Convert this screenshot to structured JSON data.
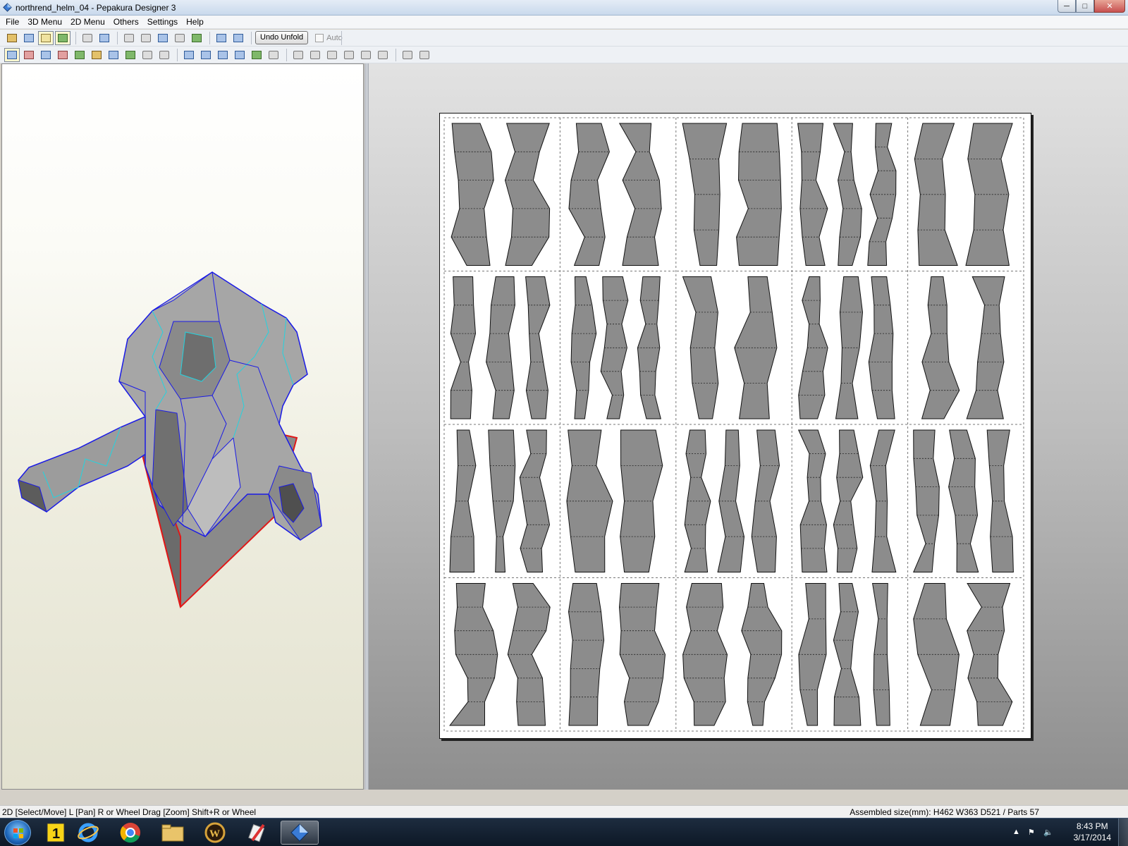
{
  "window": {
    "title": "northrend_helm_04 - Pepakura Designer 3",
    "controls": {
      "minimize": "─",
      "maximize": "□",
      "close": "✕"
    }
  },
  "menu": [
    "File",
    "3D Menu",
    "2D Menu",
    "Others",
    "Settings",
    "Help"
  ],
  "toolbar": {
    "undo_unfold_label": "Undo Unfold",
    "auto_label": "Auto",
    "auto_checked": false
  },
  "status": {
    "left": "2D [Select/Move] L [Pan] R or Wheel Drag [Zoom] Shift+R or Wheel",
    "right": "Assembled size(mm): H462 W363 D521 / Parts 57"
  },
  "taskbar": {
    "apps": [
      "start-menu",
      "1password",
      "internet-explorer",
      "chrome",
      "file-explorer",
      "world-of-warcraft",
      "paint-tool",
      "pepakura"
    ],
    "active_app": "pepakura",
    "clock_time": "8:43 PM",
    "clock_date": "3/17/2014"
  },
  "colors": {
    "piece_fill": "#8c8c8c",
    "model_edge_blue": "#1a1ae6",
    "model_edge_cyan": "#22d4e0",
    "model_edge_red": "#e01818"
  }
}
